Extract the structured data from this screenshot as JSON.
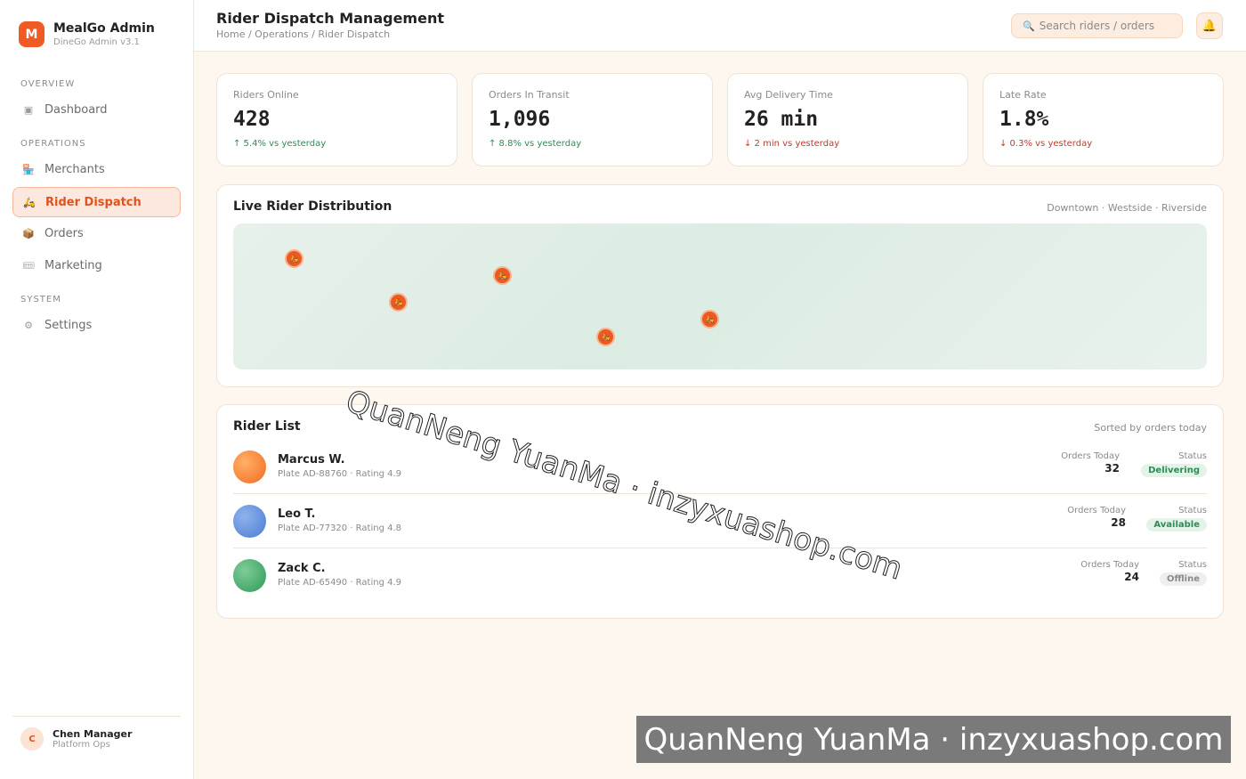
{
  "brand": {
    "logo_letter": "M",
    "name": "MealGo Admin",
    "version": "DineGo Admin v3.1",
    "accent": "#f05a24"
  },
  "nav": {
    "sections": [
      "OVERVIEW",
      "OPERATIONS",
      "SYSTEM"
    ],
    "items": [
      {
        "label": "Dashboard",
        "icon": "dashboard-icon",
        "glyph": "▣"
      },
      {
        "label": "Merchants",
        "icon": "store-icon",
        "glyph": "🏪"
      },
      {
        "label": "Rider Dispatch",
        "icon": "scooter-icon",
        "glyph": "🛵"
      },
      {
        "label": "Orders",
        "icon": "box-icon",
        "glyph": "📦"
      },
      {
        "label": "Marketing",
        "icon": "ticket-icon",
        "glyph": "🎟"
      },
      {
        "label": "Settings",
        "icon": "gear-icon",
        "glyph": "⚙"
      }
    ]
  },
  "user": {
    "initial": "C",
    "name": "Chen Manager",
    "role": "Platform Ops"
  },
  "header": {
    "title": "Rider Dispatch Management",
    "breadcrumb": "Home / Operations / Rider Dispatch",
    "search_placeholder": "Search riders / orders",
    "search_glyph": "🔍",
    "bell_glyph": "🔔"
  },
  "stats": [
    {
      "label": "Riders Online",
      "value": "428",
      "trend": "↑ 5.4% vs yesterday",
      "direction": "up"
    },
    {
      "label": "Orders In Transit",
      "value": "1,096",
      "trend": "↑ 8.8% vs yesterday",
      "direction": "up"
    },
    {
      "label": "Avg Delivery Time",
      "value": "26 min",
      "trend": "↓ 2 min vs yesterday",
      "direction": "down"
    },
    {
      "label": "Late Rate",
      "value": "1.8%",
      "trend": "↓ 0.3% vs yesterday",
      "direction": "down"
    }
  ],
  "map": {
    "title": "Live Rider Distribution",
    "areas": "Downtown · Westside · Riverside",
    "pin_glyph": "🛵"
  },
  "riders": {
    "title": "Rider List",
    "sort_note": "Sorted by orders today",
    "orders_label": "Orders Today",
    "status_label": "Status",
    "rows": [
      {
        "name": "Marcus W.",
        "sub": "Plate AD-88760 · Rating 4.9",
        "orders": "32",
        "status": "Delivering"
      },
      {
        "name": "Leo T.",
        "sub": "Plate AD-77320 · Rating 4.8",
        "orders": "28",
        "status": "Available"
      },
      {
        "name": "Zack C.",
        "sub": "Plate AD-65490 · Rating 4.9",
        "orders": "24",
        "status": "Offline"
      }
    ]
  },
  "watermark": "QuanNeng YuanMa · inzyxuashop.com"
}
